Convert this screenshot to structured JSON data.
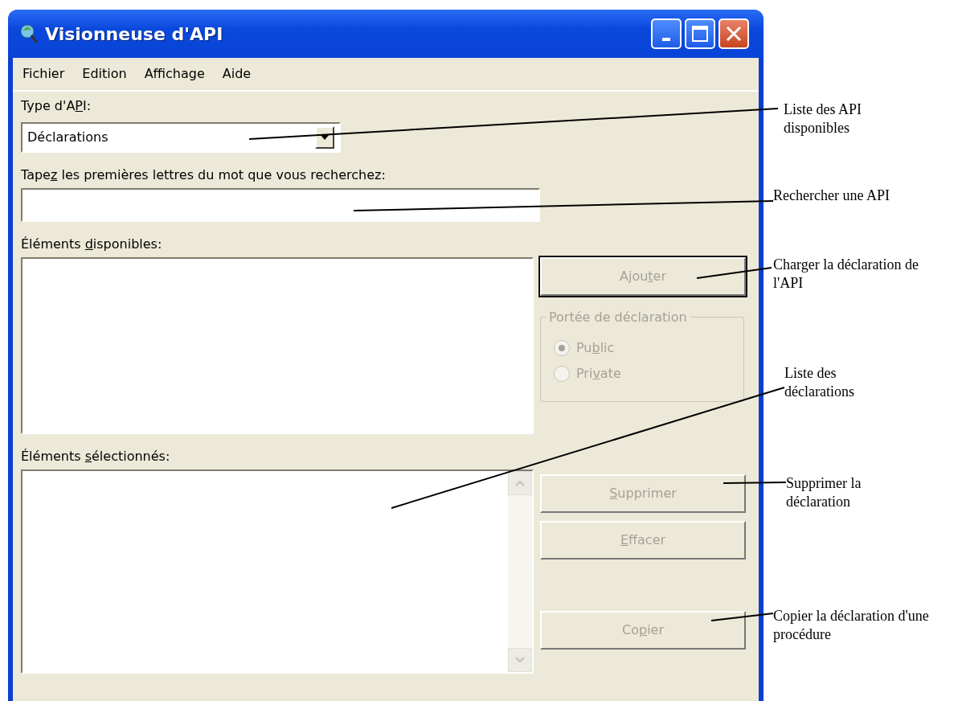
{
  "window": {
    "title": "Visionneuse d'API"
  },
  "menu": [
    {
      "label": "Fichier"
    },
    {
      "label": "Edition"
    },
    {
      "label": "Affichage"
    },
    {
      "label": "Aide"
    }
  ],
  "api_type": {
    "label": [
      "Type d'A",
      "P",
      "I:"
    ],
    "value": "Déclarations"
  },
  "search": {
    "label": [
      "Tape",
      "z",
      " les premières lettres du mot que vous recherchez:"
    ]
  },
  "available": {
    "label": [
      "Éléments ",
      "d",
      "isponibles:"
    ]
  },
  "add_button": {
    "label": [
      "Ajou",
      "t",
      "er"
    ],
    "disabled": true,
    "default": true
  },
  "scope": {
    "title": "Portée de déclaration",
    "disabled": true,
    "options": [
      {
        "label": [
          "Pu",
          "b",
          "lic"
        ],
        "selected": true
      },
      {
        "label": [
          "Pri",
          "v",
          "ate"
        ],
        "selected": false
      }
    ]
  },
  "selected_items": {
    "label": [
      "Éléments ",
      "s",
      "électionnés:"
    ]
  },
  "buttons": [
    {
      "label": [
        "S",
        "upprimer"
      ],
      "disabled": true,
      "mnemonic_first": true
    },
    {
      "label": [
        "E",
        "ffacer"
      ],
      "disabled": true,
      "mnemonic_first": true
    },
    {
      "label": [
        "Co",
        "p",
        "ier"
      ],
      "disabled": true
    }
  ],
  "callouts": [
    {
      "text": "Liste des API disponibles"
    },
    {
      "text": "Rechercher une API"
    },
    {
      "text": "Charger la déclaration de l'API"
    },
    {
      "text": "Liste des déclarations"
    },
    {
      "text": "Supprimer la déclaration"
    },
    {
      "text": "Copier la déclaration d'une procédure"
    }
  ]
}
